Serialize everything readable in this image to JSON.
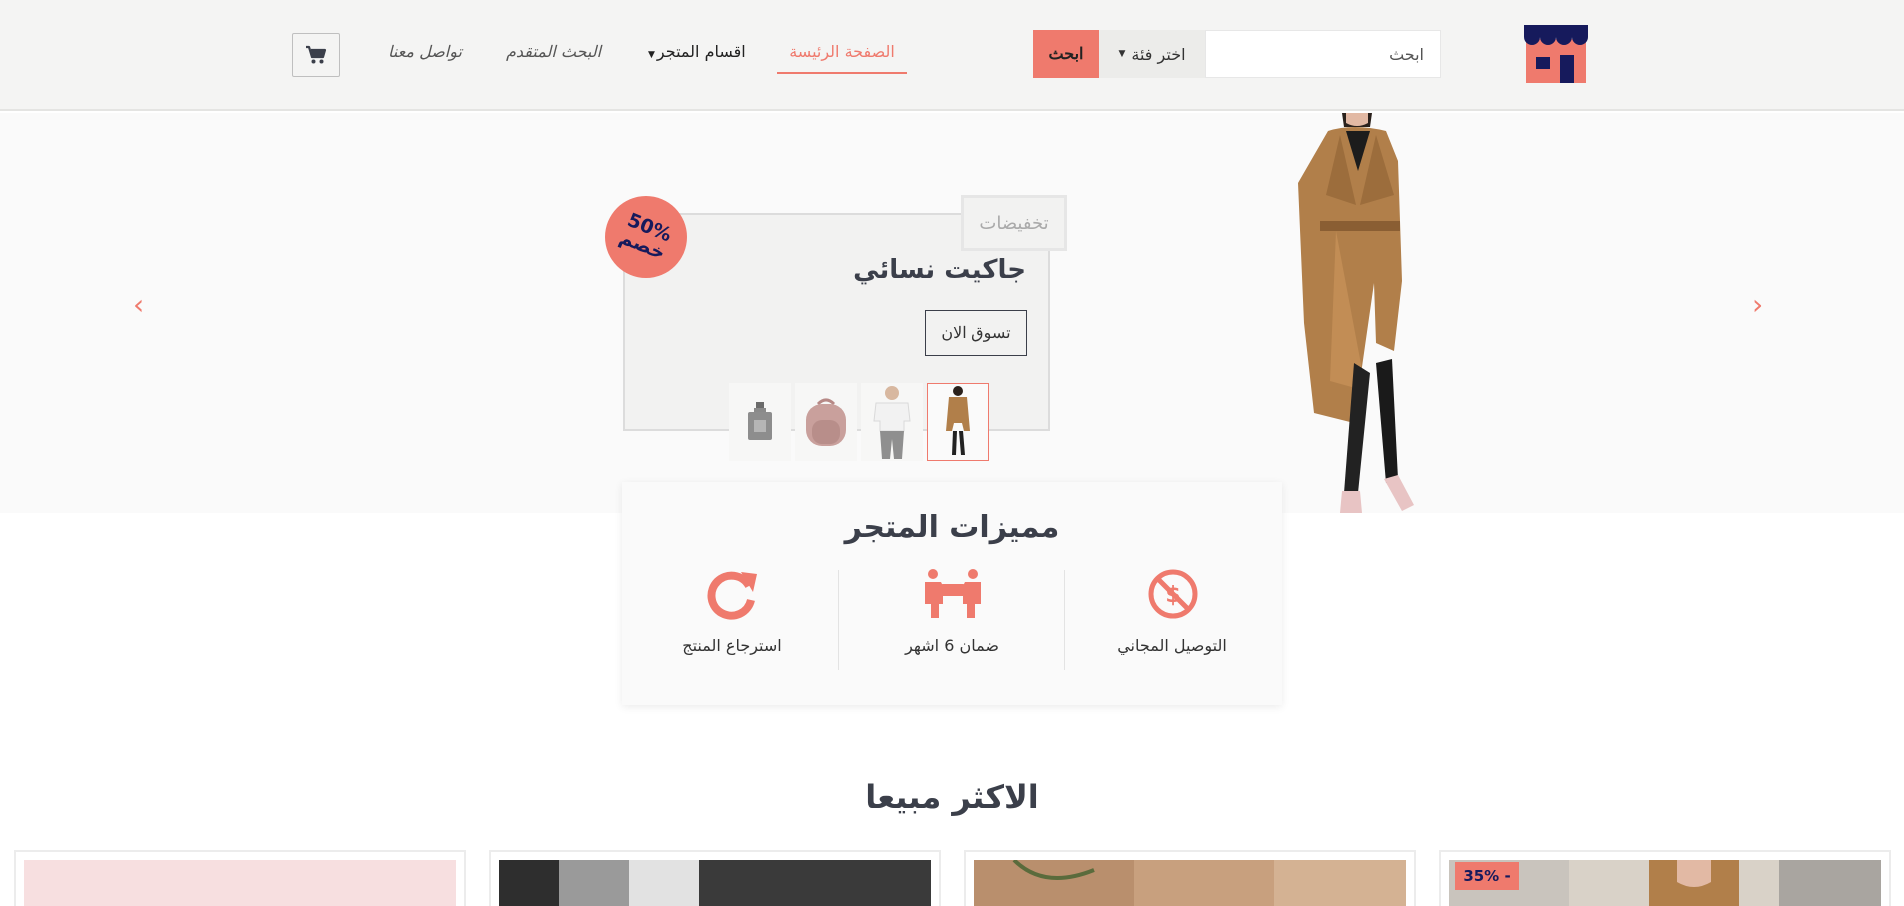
{
  "header": {
    "search": {
      "placeholder": "ابحث",
      "category_label": "اختر فئة",
      "button_label": "ابحث"
    },
    "nav": {
      "home": "الصفحة الرئيسة",
      "categories": "اقسام المتجر",
      "advanced_search": "البحث المتقدم",
      "contact": "تواصل معنا"
    },
    "icons": {
      "logo": "store-logo",
      "cart": "shopping-cart-icon"
    }
  },
  "hero": {
    "tag": "تخفيضات",
    "title": "جاكيت نسائي",
    "cta": "تسوق الان",
    "discount": {
      "percent": "50%",
      "word": "خصم"
    },
    "thumbnails": [
      "coat-woman-thumb",
      "white-tshirt-man-thumb",
      "pink-backpack-thumb",
      "perfume-bottle-thumb"
    ],
    "active_thumbnail": 0,
    "arrows": {
      "prev": "‹",
      "next": "›"
    }
  },
  "features": {
    "title": "مميزات المتجر",
    "items": [
      {
        "label": "التوصيل المجاني",
        "icon": "free-delivery-icon"
      },
      {
        "label": "ضمان 6 اشهر",
        "icon": "warranty-icon"
      },
      {
        "label": "استرجاع المنتج",
        "icon": "return-icon"
      }
    ]
  },
  "best_sellers": {
    "title": "الاكثر مبيعا",
    "sale_badge": "35% -"
  },
  "colors": {
    "accent": "#ef7a6d",
    "navy": "#161a5c",
    "text": "#3b3f4a",
    "header_bg": "#f4f4f3"
  }
}
